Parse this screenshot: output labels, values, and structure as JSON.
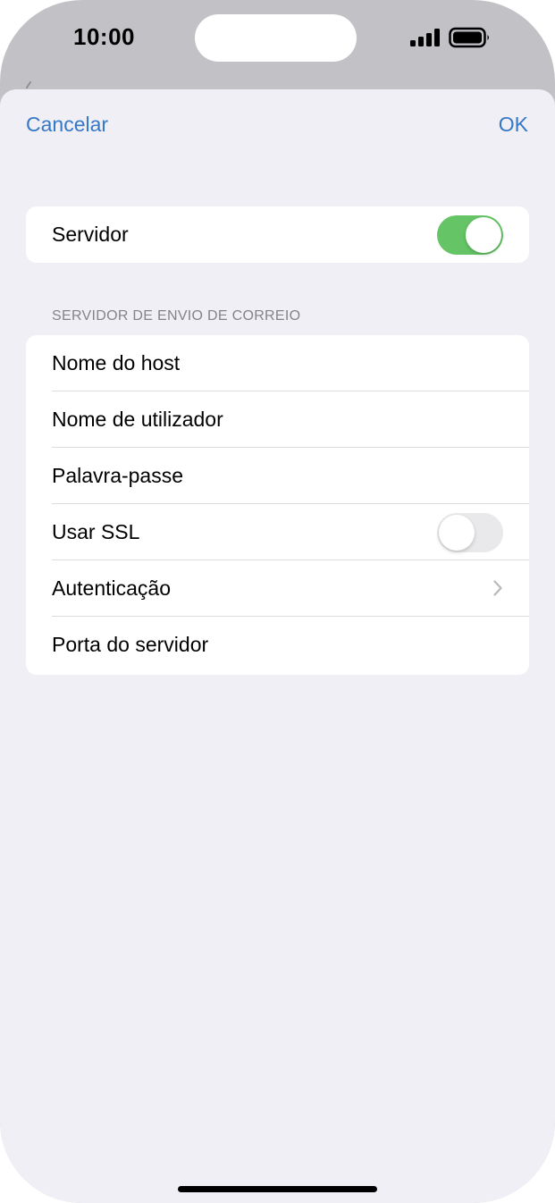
{
  "status_bar": {
    "time": "10:00",
    "signal_icon": "cellular-signal-icon",
    "battery_icon": "battery-full-icon"
  },
  "nav": {
    "cancel_label": "Cancelar",
    "ok_label": "OK",
    "accent_color": "#3478c6"
  },
  "server_toggle": {
    "label": "Servidor",
    "on": true,
    "on_color": "#65c466"
  },
  "outgoing_section": {
    "header": "SERVIDOR DE ENVIO DE CORREIO",
    "rows": [
      {
        "label": "Nome do host"
      },
      {
        "label": "Nome de utilizador"
      },
      {
        "label": "Palavra-passe"
      },
      {
        "label": "Usar SSL",
        "toggle_on": false
      },
      {
        "label": "Autenticação",
        "icon": "chevron-right-icon"
      },
      {
        "label": "Porta do servidor"
      }
    ]
  }
}
